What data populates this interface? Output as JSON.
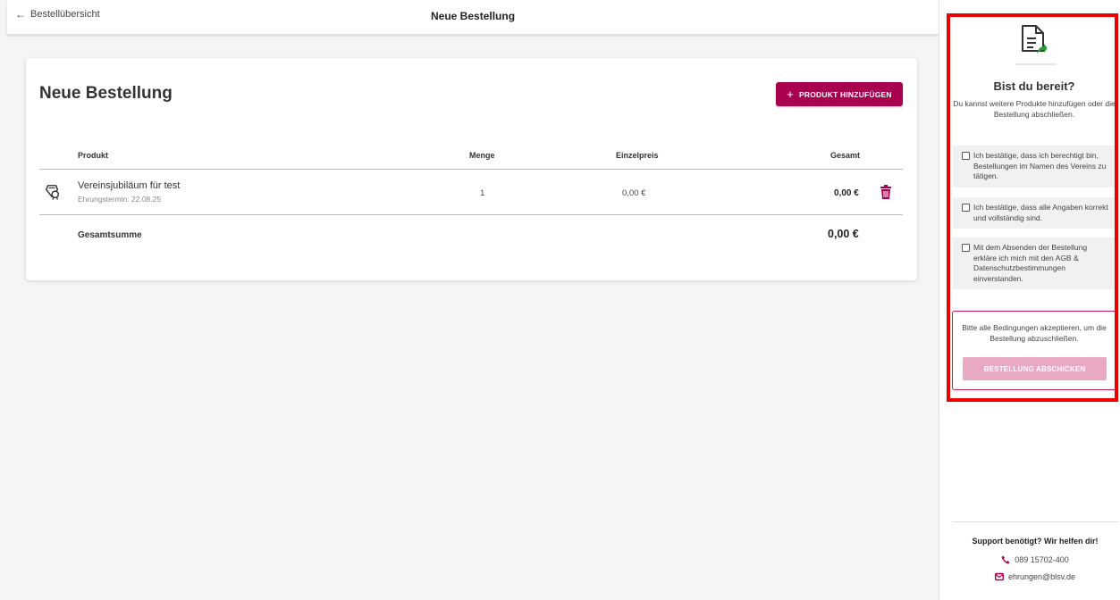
{
  "header": {
    "back_label": "Bestellübersicht",
    "title": "Neue Bestellung"
  },
  "card": {
    "title": "Neue Bestellung",
    "add_button": "PRODUKT HINZUFÜGEN",
    "columns": {
      "product": "Produkt",
      "quantity": "Menge",
      "unit_price": "Einzelpreis",
      "total": "Gesamt"
    },
    "rows": [
      {
        "name": "Vereinsjubiläum für test",
        "sub": "Ehrungstermin: 22.08.25",
        "quantity": "1",
        "unit_price": "0,00 €",
        "total": "0,00 €"
      }
    ],
    "sum_label": "Gesamtsumme",
    "sum_value": "0,00 €"
  },
  "sidebar": {
    "title": "Bist du bereit?",
    "text": "Du kannst weitere Produkte hinzufügen oder die Bestellung abschließen.",
    "checks": [
      "Ich bestätige, dass ich berechtigt bin, Bestellungen im Namen des Vereins zu tätigen.",
      "Ich bestätige, dass alle Angaben korrekt und vollständig sind.",
      "Mit dem Absenden der Bestellung erkläre ich mich mit den AGB & Datenschutzbestimmungen einverstanden."
    ],
    "submit_text": "Bitte alle Bedingungen akzeptieren, um die Bestellung abzuschließen.",
    "submit_button": "BESTELLUNG ABSCHICKEN",
    "support_title": "Support benötigt? Wir helfen dir!",
    "phone": "089 15702-400",
    "email": "ehrungen@blsv.de"
  },
  "colors": {
    "brand": "#a8004f",
    "disabled_button": "#e9a9c5",
    "highlight": "#ee0000",
    "doc_arrow": "#2e9e3b"
  },
  "icons": [
    "arrow-left-icon",
    "plus-icon",
    "medal-icon",
    "trash-icon",
    "document-send-icon",
    "phone-icon",
    "mail-icon"
  ]
}
